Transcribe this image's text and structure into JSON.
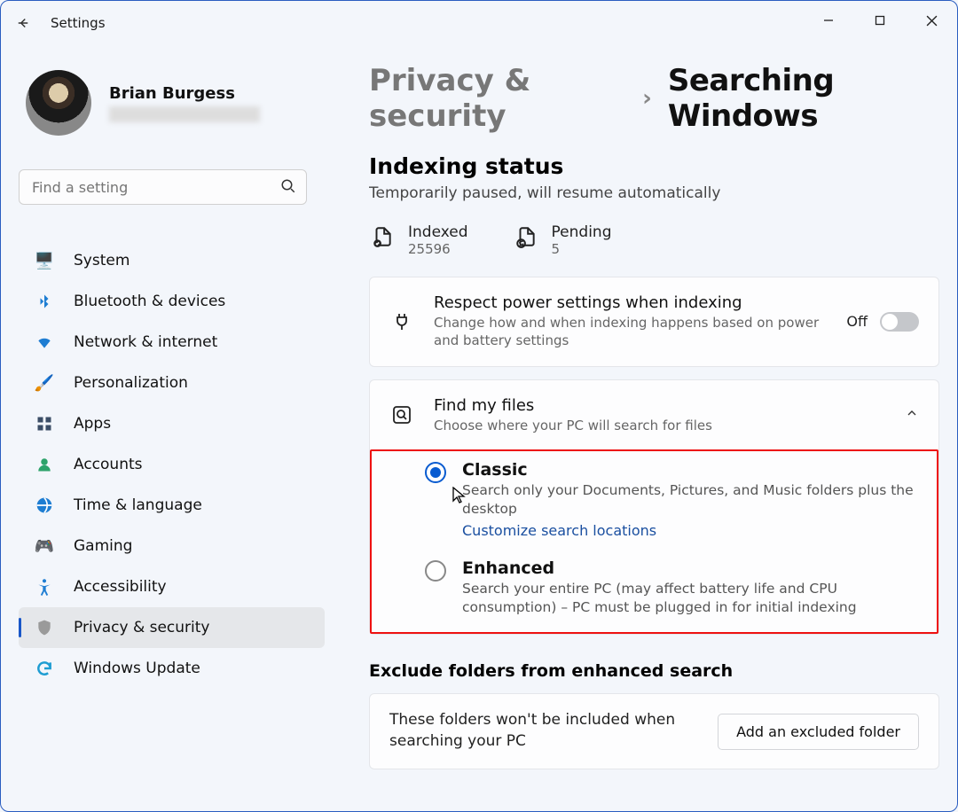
{
  "app": {
    "title": "Settings"
  },
  "user": {
    "name": "Brian Burgess"
  },
  "search": {
    "placeholder": "Find a setting"
  },
  "nav": {
    "items": [
      {
        "label": "System",
        "icon": "monitor-icon",
        "color": "#1e7dd2"
      },
      {
        "label": "Bluetooth & devices",
        "icon": "bluetooth-icon",
        "color": "#1e7dd2"
      },
      {
        "label": "Network & internet",
        "icon": "wifi-icon",
        "color": "#1e7dd2"
      },
      {
        "label": "Personalization",
        "icon": "paintbrush-icon",
        "color": "#d88b2f"
      },
      {
        "label": "Apps",
        "icon": "apps-icon",
        "color": "#3b4d66"
      },
      {
        "label": "Accounts",
        "icon": "person-icon",
        "color": "#2da36b"
      },
      {
        "label": "Time & language",
        "icon": "globe-icon",
        "color": "#1e7dd2"
      },
      {
        "label": "Gaming",
        "icon": "gamepad-icon",
        "color": "#8a8a8a"
      },
      {
        "label": "Accessibility",
        "icon": "accessibility-icon",
        "color": "#1e7dd2"
      },
      {
        "label": "Privacy & security",
        "icon": "shield-icon",
        "color": "#8a8a8a"
      },
      {
        "label": "Windows Update",
        "icon": "update-icon",
        "color": "#1e9dd2"
      }
    ]
  },
  "breadcrumb": {
    "root": "Privacy & security",
    "leaf": "Searching Windows"
  },
  "indexing": {
    "heading": "Indexing status",
    "subtitle": "Temporarily paused, will resume automatically",
    "indexed_label": "Indexed",
    "indexed_value": "25596",
    "pending_label": "Pending",
    "pending_value": "5"
  },
  "power_card": {
    "title": "Respect power settings when indexing",
    "sub": "Change how and when indexing happens based on power and battery settings",
    "toggle_state": "Off"
  },
  "find_card": {
    "title": "Find my files",
    "sub": "Choose where your PC will search for files"
  },
  "radios": {
    "classic": {
      "title": "Classic",
      "sub": "Search only your Documents, Pictures, and Music folders plus the desktop",
      "link": "Customize search locations"
    },
    "enhanced": {
      "title": "Enhanced",
      "sub": "Search your entire PC (may affect battery life and CPU consumption) – PC must be plugged in for initial indexing"
    }
  },
  "exclude": {
    "heading": "Exclude folders from enhanced search",
    "text": "These folders won't be included when searching your PC",
    "button": "Add an excluded folder"
  }
}
